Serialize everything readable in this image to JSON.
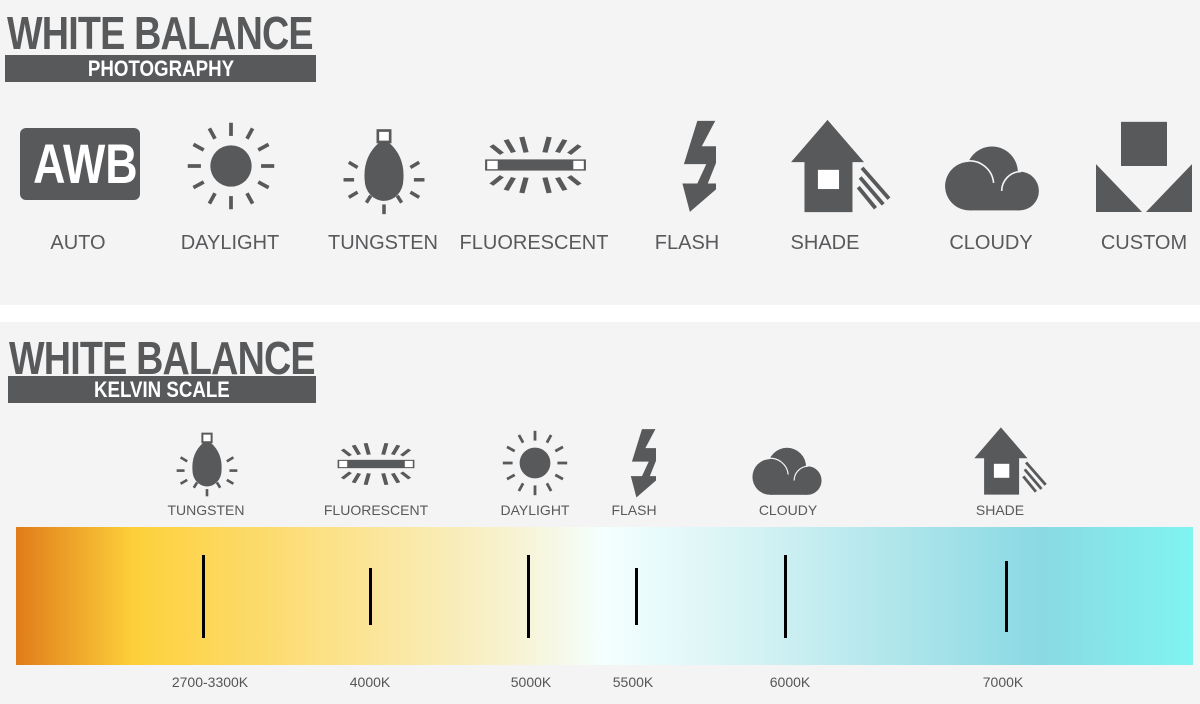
{
  "section1": {
    "title": "WHITE BALANCE",
    "subtitle": "PHOTOGRAPHY",
    "items": [
      {
        "label": "AUTO",
        "icon": "awb-icon",
        "icon_text": "AWB"
      },
      {
        "label": "DAYLIGHT",
        "icon": "sun-icon"
      },
      {
        "label": "TUNGSTEN",
        "icon": "tungsten-bulb-icon"
      },
      {
        "label": "FLUORESCENT",
        "icon": "fluorescent-tube-icon"
      },
      {
        "label": "FLASH",
        "icon": "lightning-icon"
      },
      {
        "label": "SHADE",
        "icon": "house-shade-icon"
      },
      {
        "label": "CLOUDY",
        "icon": "cloud-icon"
      },
      {
        "label": "CUSTOM",
        "icon": "custom-shapes-icon"
      }
    ]
  },
  "section2": {
    "title": "WHITE BALANCE",
    "subtitle": "KELVIN SCALE",
    "sources": [
      {
        "label": "TUNGSTEN",
        "icon": "tungsten-bulb-icon"
      },
      {
        "label": "FLUORESCENT",
        "icon": "fluorescent-tube-icon"
      },
      {
        "label": "DAYLIGHT",
        "icon": "sun-icon"
      },
      {
        "label": "FLASH",
        "icon": "lightning-icon"
      },
      {
        "label": "CLOUDY",
        "icon": "cloud-icon"
      },
      {
        "label": "SHADE",
        "icon": "house-shade-icon"
      }
    ],
    "scale_labels": [
      "2700-3300K",
      "4000K",
      "5000K",
      "5500K",
      "6000K",
      "7000K"
    ],
    "gradient_colors": [
      "#e07c1a",
      "#fdd03a",
      "#fcdf7f",
      "#f7f2d0",
      "#f4ffff",
      "#d6f3f4",
      "#8ad9e3",
      "#7ff4f0"
    ]
  },
  "colors": {
    "icon": "#58595b",
    "background": "#f4f4f4"
  }
}
